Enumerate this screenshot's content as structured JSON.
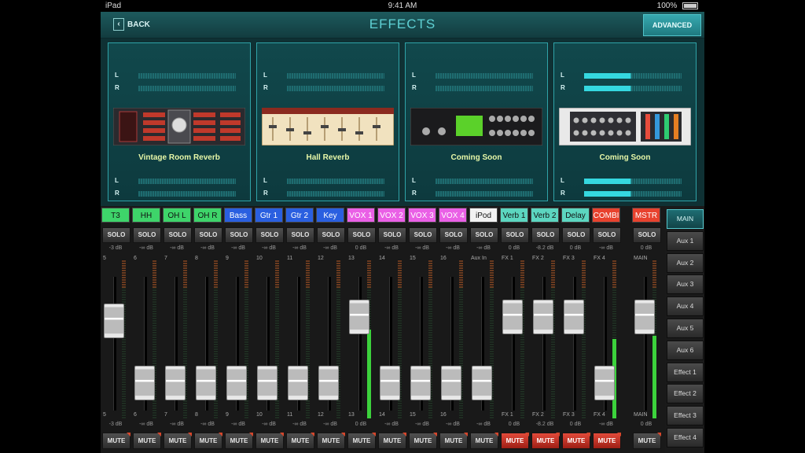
{
  "status": {
    "carrier": "iPad",
    "time": "9:41 AM",
    "battery": "100%"
  },
  "nav": {
    "back_label": "BACK",
    "title": "EFFECTS",
    "advanced_label": "ADVANCED"
  },
  "effects": [
    {
      "name": "Vintage Room Reverb",
      "thumb": "vintage",
      "lit": false
    },
    {
      "name": "Hall Reverb",
      "thumb": "hall",
      "lit": false
    },
    {
      "name": "Coming Soon",
      "thumb": "stereo-delay",
      "lit": false
    },
    {
      "name": "Coming Soon",
      "thumb": "multi-fx",
      "lit": true
    }
  ],
  "meter_labels": {
    "l": "L",
    "r": "R"
  },
  "colors": {
    "accent": "#2fa3a8",
    "title": "#5fd1d4",
    "slot_name": "#e7f7a8",
    "mute_on": "#d23a2a",
    "meter_green": "#3cd23c"
  },
  "channels": [
    {
      "label": "T3",
      "color": "#3ed46a",
      "text": "#111",
      "gain_top": "-3 dB",
      "gain_bottom": "-3 dB",
      "num_top": "5",
      "num_bottom": "5",
      "fader": 0.73,
      "meter": 0.0,
      "mute_on": false
    },
    {
      "label": "HH",
      "color": "#3ed46a",
      "text": "#111",
      "gain_top": "-∞ dB",
      "gain_bottom": "-∞ dB",
      "num_top": "6",
      "num_bottom": "6",
      "fader": 0.1,
      "meter": 0.0,
      "mute_on": false
    },
    {
      "label": "OH L",
      "color": "#3ed46a",
      "text": "#111",
      "gain_top": "-∞ dB",
      "gain_bottom": "-∞ dB",
      "num_top": "7",
      "num_bottom": "7",
      "fader": 0.1,
      "meter": 0.0,
      "mute_on": false
    },
    {
      "label": "OH R",
      "color": "#3ed46a",
      "text": "#111",
      "gain_top": "-∞ dB",
      "gain_bottom": "-∞ dB",
      "num_top": "8",
      "num_bottom": "8",
      "fader": 0.1,
      "meter": 0.0,
      "mute_on": false
    },
    {
      "label": "Bass",
      "color": "#2a5fe0",
      "text": "#fff",
      "gain_top": "-∞ dB",
      "gain_bottom": "-∞ dB",
      "num_top": "9",
      "num_bottom": "9",
      "fader": 0.1,
      "meter": 0.0,
      "mute_on": false
    },
    {
      "label": "Gtr 1",
      "color": "#2a5fe0",
      "text": "#fff",
      "gain_top": "-∞ dB",
      "gain_bottom": "-∞ dB",
      "num_top": "10",
      "num_bottom": "10",
      "fader": 0.1,
      "meter": 0.0,
      "mute_on": false
    },
    {
      "label": "Gtr 2",
      "color": "#2a5fe0",
      "text": "#fff",
      "gain_top": "-∞ dB",
      "gain_bottom": "-∞ dB",
      "num_top": "11",
      "num_bottom": "11",
      "fader": 0.1,
      "meter": 0.0,
      "mute_on": false
    },
    {
      "label": "Key",
      "color": "#2a5fe0",
      "text": "#fff",
      "gain_top": "-∞ dB",
      "gain_bottom": "-∞ dB",
      "num_top": "12",
      "num_bottom": "12",
      "fader": 0.1,
      "meter": 0.0,
      "mute_on": false
    },
    {
      "label": "VOX 1",
      "color": "#ea60e6",
      "text": "#fff",
      "gain_top": "0 dB",
      "gain_bottom": "0 dB",
      "num_top": "13",
      "num_bottom": "13",
      "fader": 0.77,
      "meter": 0.56,
      "mute_on": false
    },
    {
      "label": "VOX 2",
      "color": "#ea60e6",
      "text": "#fff",
      "gain_top": "-∞ dB",
      "gain_bottom": "-∞ dB",
      "num_top": "14",
      "num_bottom": "14",
      "fader": 0.1,
      "meter": 0.0,
      "mute_on": false
    },
    {
      "label": "VOX 3",
      "color": "#ea60e6",
      "text": "#fff",
      "gain_top": "-∞ dB",
      "gain_bottom": "-∞ dB",
      "num_top": "15",
      "num_bottom": "15",
      "fader": 0.1,
      "meter": 0.0,
      "mute_on": false
    },
    {
      "label": "VOX 4",
      "color": "#ea60e6",
      "text": "#fff",
      "gain_top": "-∞ dB",
      "gain_bottom": "-∞ dB",
      "num_top": "16",
      "num_bottom": "16",
      "fader": 0.1,
      "meter": 0.0,
      "mute_on": false
    },
    {
      "label": "iPod",
      "color": "#f2f2f2",
      "text": "#111",
      "gain_top": "-∞ dB",
      "gain_bottom": "-∞ dB",
      "num_top": "Aux In",
      "num_bottom": "",
      "fader": 0.1,
      "meter": 0.0,
      "mute_on": false
    },
    {
      "label": "Verb 1",
      "color": "#5cd6c0",
      "text": "#111",
      "gain_top": "0 dB",
      "gain_bottom": "0 dB",
      "num_top": "FX 1",
      "num_bottom": "FX 1",
      "fader": 0.77,
      "meter": 0.0,
      "mute_on": true
    },
    {
      "label": "Verb 2",
      "color": "#5cd6c0",
      "text": "#111",
      "gain_top": "-8.2 dB",
      "gain_bottom": "-8.2 dB",
      "num_top": "FX 2",
      "num_bottom": "FX 2",
      "fader": 0.77,
      "meter": 0.0,
      "mute_on": true
    },
    {
      "label": "Delay",
      "color": "#5cd6c0",
      "text": "#111",
      "gain_top": "0 dB",
      "gain_bottom": "0 dB",
      "num_top": "FX 3",
      "num_bottom": "FX 3",
      "fader": 0.77,
      "meter": 0.0,
      "mute_on": true
    },
    {
      "label": "COMBI",
      "color": "#e8422e",
      "text": "#fff",
      "gain_top": "-∞ dB",
      "gain_bottom": "-∞ dB",
      "num_top": "FX 4",
      "num_bottom": "FX 4",
      "fader": 0.1,
      "meter": 0.5,
      "mute_on": true
    },
    {
      "label": "MSTR",
      "color": "#e8422e",
      "text": "#fff",
      "gain_top": "0 dB",
      "gain_bottom": "0 dB",
      "num_top": "MAIN",
      "num_bottom": "MAIN",
      "fader": 0.77,
      "meter": 0.52,
      "mute_on": false
    }
  ],
  "solo_label": "SOLO",
  "mute_label": "MUTE",
  "buses": [
    {
      "label": "MAIN",
      "active": true
    },
    {
      "label": "Aux 1",
      "active": false
    },
    {
      "label": "Aux 2",
      "active": false
    },
    {
      "label": "Aux 3",
      "active": false
    },
    {
      "label": "Aux 4",
      "active": false
    },
    {
      "label": "Aux 5",
      "active": false
    },
    {
      "label": "Aux 6",
      "active": false
    },
    {
      "label": "Effect 1",
      "active": false
    },
    {
      "label": "Effect 2",
      "active": false
    },
    {
      "label": "Effect 3",
      "active": false
    },
    {
      "label": "Effect 4",
      "active": false
    }
  ]
}
